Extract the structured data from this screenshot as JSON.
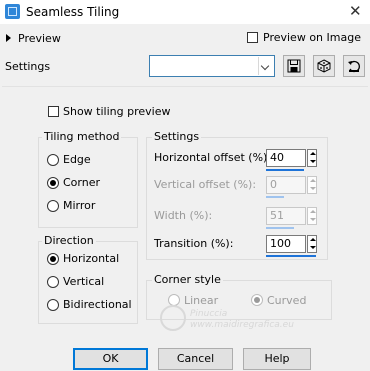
{
  "window": {
    "title": "Seamless Tiling",
    "close_glyph": "✕"
  },
  "top": {
    "preview_label": "Preview",
    "preview_on_image_label": "Preview on Image",
    "settings_label": "Settings",
    "preset_value": ""
  },
  "show_tiling_preview_label": "Show tiling preview",
  "tiling_method": {
    "title": "Tiling method",
    "options": [
      "Edge",
      "Corner",
      "Mirror"
    ],
    "selected": "Corner"
  },
  "direction": {
    "title": "Direction",
    "options": [
      "Horizontal",
      "Vertical",
      "Bidirectional"
    ],
    "selected": "Horizontal"
  },
  "settings_group": {
    "title": "Settings",
    "horizontal_offset": {
      "label": "Horizontal offset (%):",
      "value": "40"
    },
    "vertical_offset": {
      "label": "Vertical offset (%):",
      "value": "0"
    },
    "width": {
      "label": "Width (%):",
      "value": "51"
    },
    "transition": {
      "label": "Transition (%):",
      "value": "100"
    }
  },
  "corner_style": {
    "title": "Corner style",
    "options": [
      "Linear",
      "Curved"
    ],
    "selected": "Curved"
  },
  "watermark": {
    "line1": "Pinuccia",
    "line2": "www.maidiregrafica.eu"
  },
  "buttons": {
    "ok": "OK",
    "cancel": "Cancel",
    "help": "Help"
  },
  "colors": {
    "accent": "#1e73d8",
    "titlebar_icon": "#2f86d8"
  }
}
